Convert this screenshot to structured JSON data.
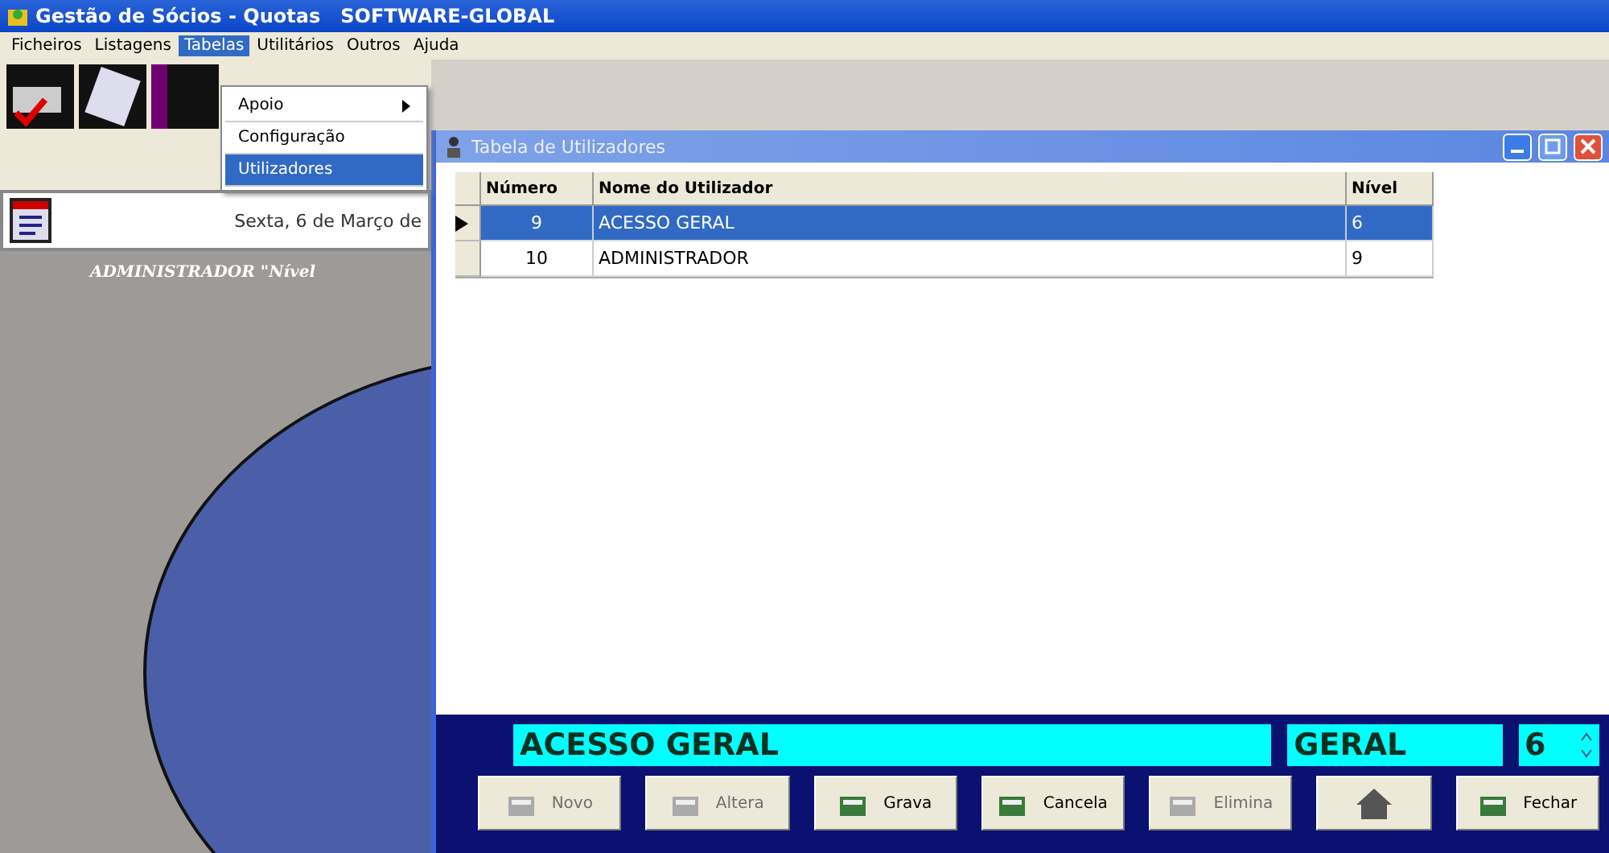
{
  "window": {
    "title": "Gestão de Sócios - Quotas   SOFTWARE-GLOBAL"
  },
  "menu": [
    {
      "label": "Ficheiros",
      "selected": false
    },
    {
      "label": "Listagens",
      "selected": false
    },
    {
      "label": "Tabelas",
      "selected": true
    },
    {
      "label": "Utilitários",
      "selected": false
    },
    {
      "label": "Outros",
      "selected": false
    },
    {
      "label": "Ajuda",
      "selected": false
    }
  ],
  "dropdown": [
    {
      "label": "Apoio",
      "submenu": true,
      "selected": false
    },
    {
      "label": "Configuração",
      "submenu": false,
      "selected": false
    },
    {
      "label": "Utilizadores",
      "submenu": false,
      "selected": true
    }
  ],
  "side_panel": {
    "date": "Sexta, 6 de Março de",
    "user": "ADMINISTRADOR \"Nível"
  },
  "child_window": {
    "title": "Tabela de Utilizadores",
    "columns": [
      "Número",
      "Nome do Utilizador",
      "Nível"
    ],
    "rows": [
      {
        "cells": [
          "9",
          "ACESSO GERAL",
          "6"
        ],
        "selected": true
      },
      {
        "cells": [
          "10",
          "ADMINISTRADOR",
          "9"
        ],
        "selected": false
      }
    ],
    "name_field": "ACESSO GERAL",
    "level_name": "GERAL",
    "level_value": "6",
    "buttons": [
      {
        "kind": "text",
        "label": "Novo",
        "disabled": true
      },
      {
        "kind": "text",
        "label": "Altera",
        "disabled": true
      },
      {
        "kind": "text",
        "label": "Grava",
        "disabled": false
      },
      {
        "kind": "text",
        "label": "Cancela",
        "disabled": false
      },
      {
        "kind": "text",
        "label": "Elimina",
        "disabled": true
      },
      {
        "kind": "icon",
        "disabled": false
      },
      {
        "kind": "text",
        "label": "Fechar",
        "disabled": false
      }
    ]
  }
}
